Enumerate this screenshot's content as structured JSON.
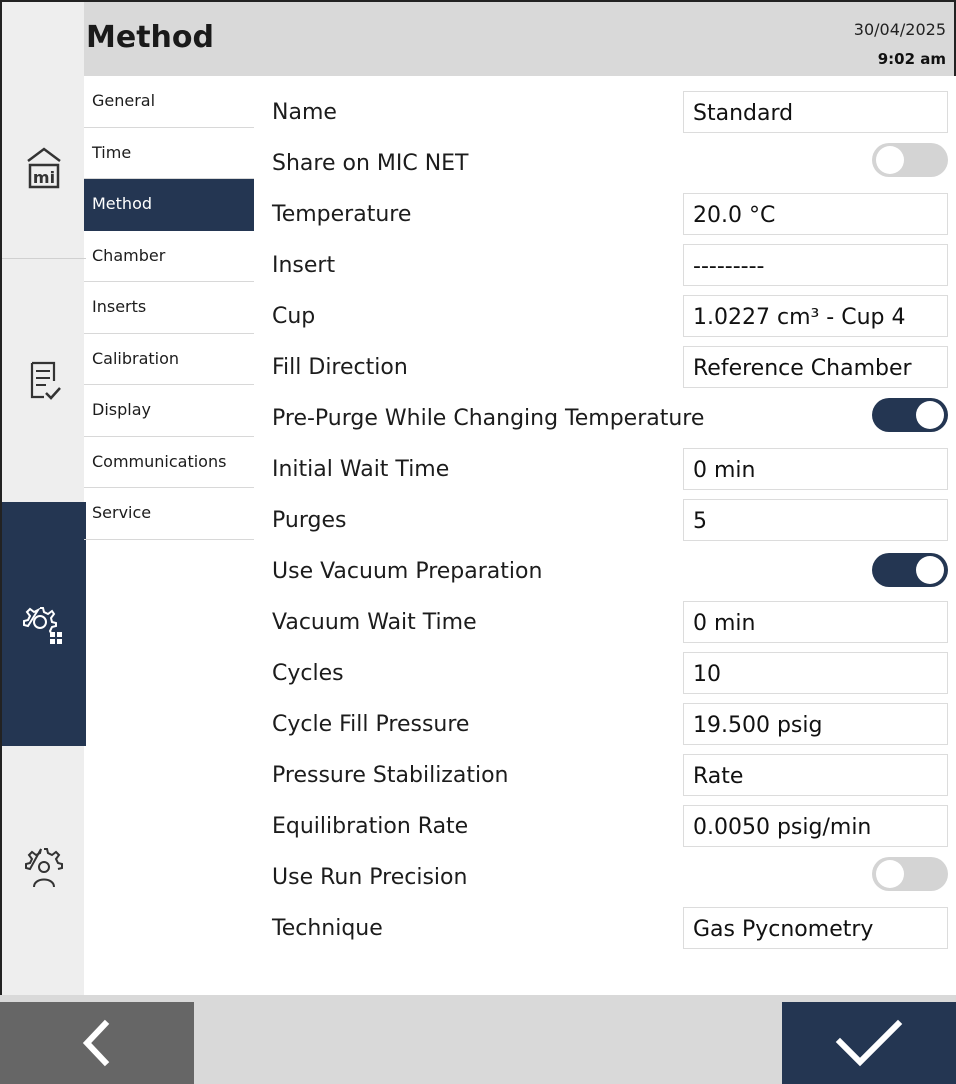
{
  "header": {
    "title": "Method",
    "date": "30/04/2025",
    "time": "9:02 am"
  },
  "rail": {
    "items": [
      {
        "icon": "home-mi-icon"
      },
      {
        "icon": "checklist-icon"
      },
      {
        "icon": "settings-grid-icon",
        "active": true
      },
      {
        "icon": "user-settings-icon"
      }
    ]
  },
  "subnav": {
    "items": [
      {
        "label": "General"
      },
      {
        "label": "Time"
      },
      {
        "label": "Method",
        "active": true
      },
      {
        "label": "Chamber"
      },
      {
        "label": "Inserts"
      },
      {
        "label": "Calibration"
      },
      {
        "label": "Display"
      },
      {
        "label": "Communications"
      },
      {
        "label": "Service"
      }
    ]
  },
  "form": {
    "name": {
      "label": "Name",
      "value": "Standard"
    },
    "share": {
      "label": "Share on MIC NET",
      "on": false
    },
    "temperature": {
      "label": "Temperature",
      "value": "20.0  °C"
    },
    "insert": {
      "label": "Insert",
      "value": "---------"
    },
    "cup": {
      "label": "Cup",
      "value": "1.0227 cm³ - Cup 4"
    },
    "fill_direction": {
      "label": "Fill Direction",
      "value": "Reference Chamber"
    },
    "pre_purge": {
      "label": "Pre-Purge While Changing Temperature",
      "on": true
    },
    "initial_wait": {
      "label": "Initial Wait Time",
      "value": "0  min"
    },
    "purges": {
      "label": "Purges",
      "value": "5"
    },
    "vacuum_prep": {
      "label": "Use Vacuum Preparation",
      "on": true
    },
    "vacuum_wait": {
      "label": "Vacuum Wait Time",
      "value": "0  min"
    },
    "cycles": {
      "label": "Cycles",
      "value": "10"
    },
    "cycle_fill": {
      "label": "Cycle Fill Pressure",
      "value": "19.500  psig"
    },
    "pressure_stab": {
      "label": "Pressure Stabilization",
      "value": "Rate"
    },
    "equil_rate": {
      "label": "Equilibration Rate",
      "value": "0.0050  psig/min"
    },
    "run_precision": {
      "label": "Use Run Precision",
      "on": false
    },
    "technique": {
      "label": "Technique",
      "value": "Gas Pycnometry"
    }
  },
  "footer": {
    "back_icon": "chevron-left-icon",
    "confirm_icon": "checkmark-icon"
  },
  "colors": {
    "accent": "#243652",
    "header_bg": "#d9d9d9",
    "rail_bg": "#eeeeee",
    "back_btn": "#666666"
  }
}
